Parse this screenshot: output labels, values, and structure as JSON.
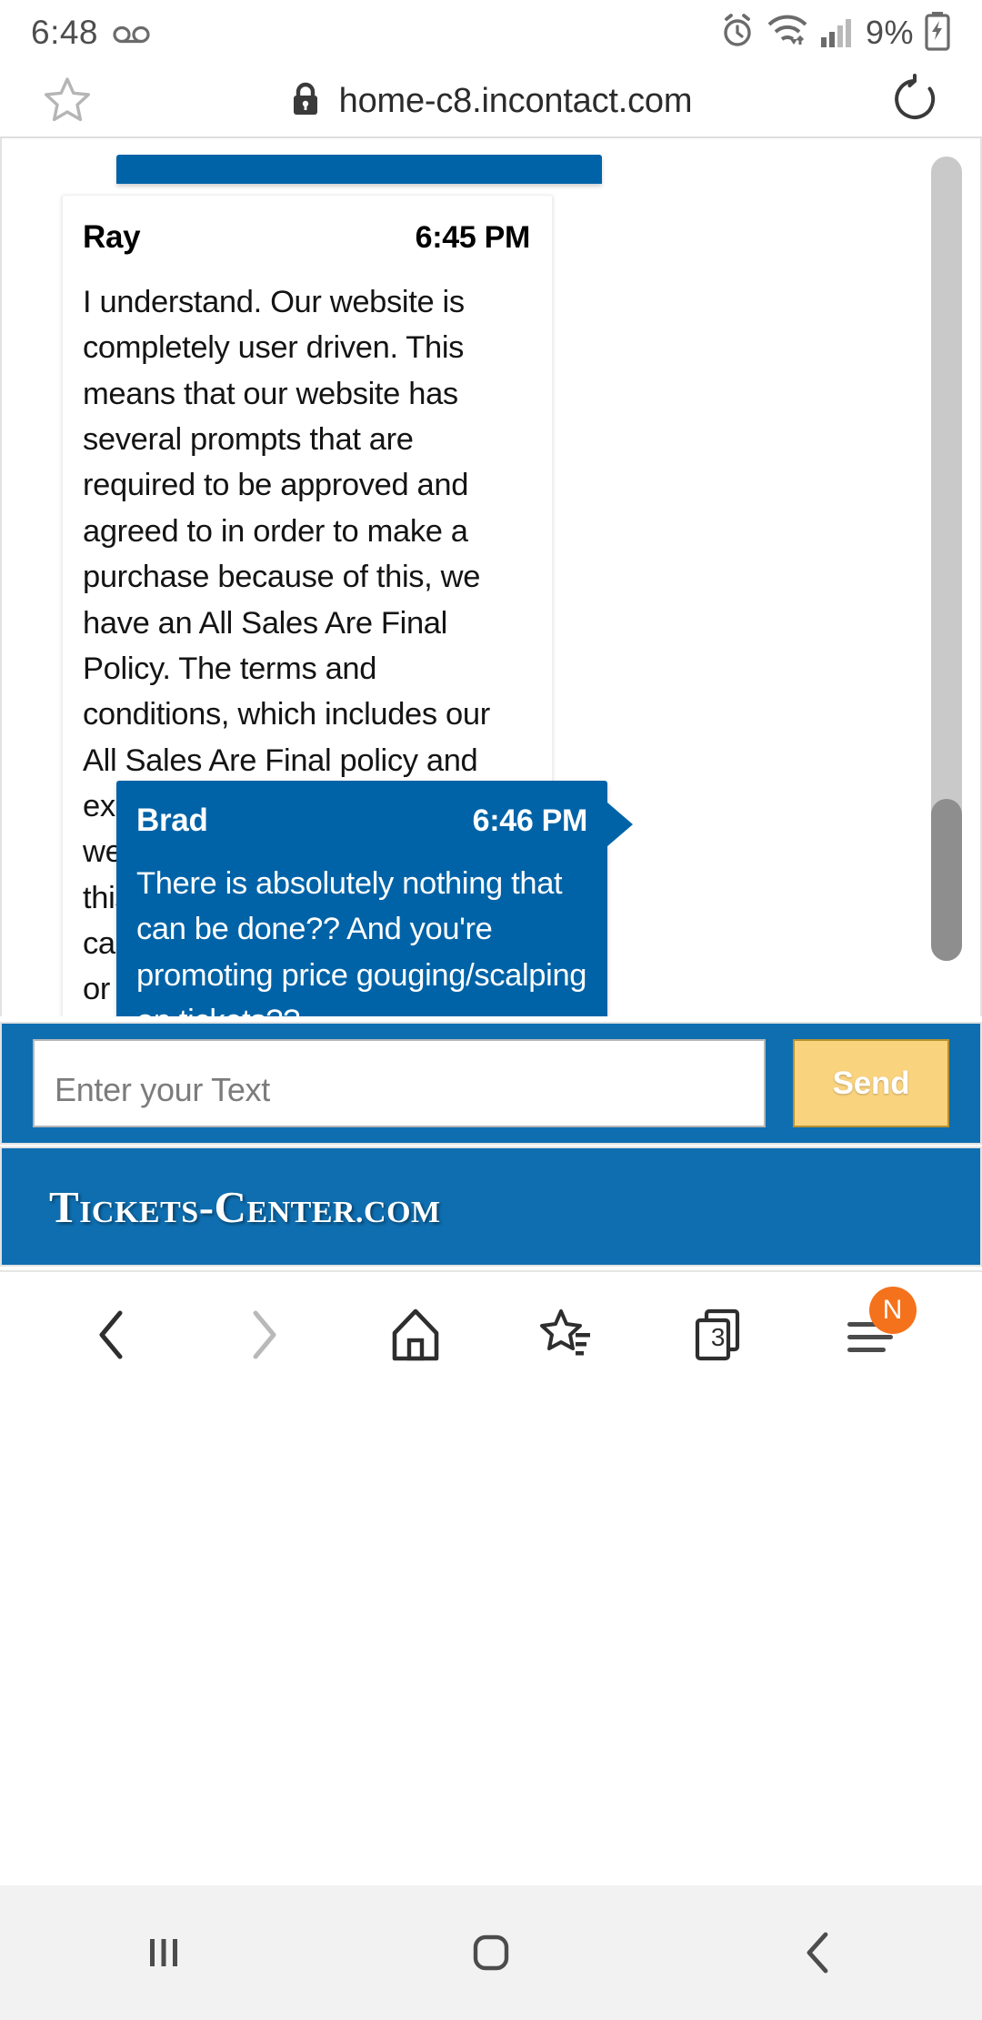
{
  "status_bar": {
    "time": "6:48",
    "voicemail_icon": "voicemail-icon",
    "alarm_icon": "alarm-icon",
    "wifi_icon": "wifi-icon",
    "signal_icon": "cellular-signal-icon",
    "battery_percent": "9%",
    "battery_icon": "battery-charging-icon"
  },
  "browser": {
    "bookmark_icon": "star-outline-icon",
    "lock_icon": "lock-icon",
    "url": "home-c8.incontact.com",
    "reload_icon": "reload-icon",
    "toolbar": {
      "back_icon": "chevron-left-icon",
      "forward_icon": "chevron-right-icon",
      "home_icon": "home-icon",
      "bookmarks_icon": "star-list-icon",
      "tabs_icon": "tabs-icon",
      "tab_count": "3",
      "menu_icon": "hamburger-menu-icon",
      "menu_badge": "N"
    }
  },
  "chat": {
    "messages": [
      {
        "sender": "Ray",
        "time": "6:45 PM",
        "body": "I understand. Our website is completely user driven. This means that our website has several prompts that are required to be approved and agreed to in order to make a purchase because of this, we have an All Sales Are Final Policy. The terms and conditions, which includes our All Sales Are Final policy and explains that price changes, were agreed to in order to make this purchase. We are unable to cancel this order, issue a refund or exchange. I understand this can be very frustrating. You are more than welcome to resell the tickets on an independent platform, if you'd like. I definitely understand that this is not the requested resolution, however, reselling tickets is a great way to recoup the cost and there is even opportunity for profit.",
        "type": "agent"
      },
      {
        "sender": "Brad",
        "time": "6:46 PM",
        "body": "There is absolutely nothing that can be done?? And you're promoting price gouging/scalping on tickets??",
        "type": "customer"
      }
    ]
  },
  "composer": {
    "placeholder": "Enter your Text",
    "value": "",
    "send_label": "Send"
  },
  "site_footer": {
    "brand_main": "T",
    "brand_rest": "ICKETS",
    "brand_dash": "-C",
    "brand_center": "ENTER",
    "brand_dot": ".",
    "brand_com": "COM"
  },
  "android_nav": {
    "recents_icon": "recents-icon",
    "home_icon": "home-circle-icon",
    "back_icon": "back-chevron-icon"
  },
  "colors": {
    "brand_blue": "#0063a7",
    "footer_blue": "#0e6eb0",
    "send_yellow": "#fad37e",
    "badge_orange": "#f4721b"
  }
}
